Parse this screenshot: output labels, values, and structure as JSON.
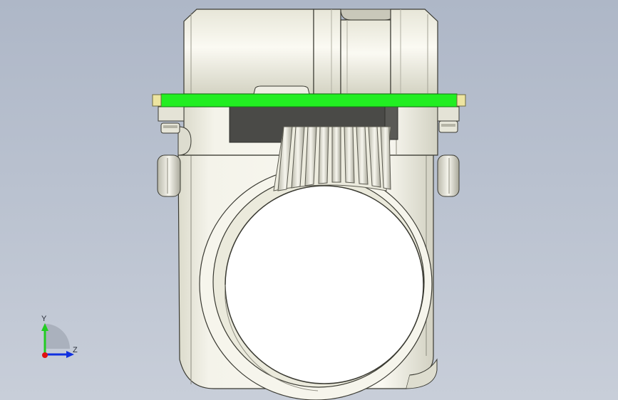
{
  "view": {
    "background_top": "#aeb7c7",
    "background_bottom": "#c8ced9",
    "part_color": "#f0efe6",
    "pcb_color": "#22ee22",
    "connector_color": "#4a4a47"
  },
  "triad": {
    "y_label": "Y",
    "z_label": "Z",
    "y_color": "#22cc22",
    "z_color": "#1030e0",
    "x_color": "#e01010"
  }
}
